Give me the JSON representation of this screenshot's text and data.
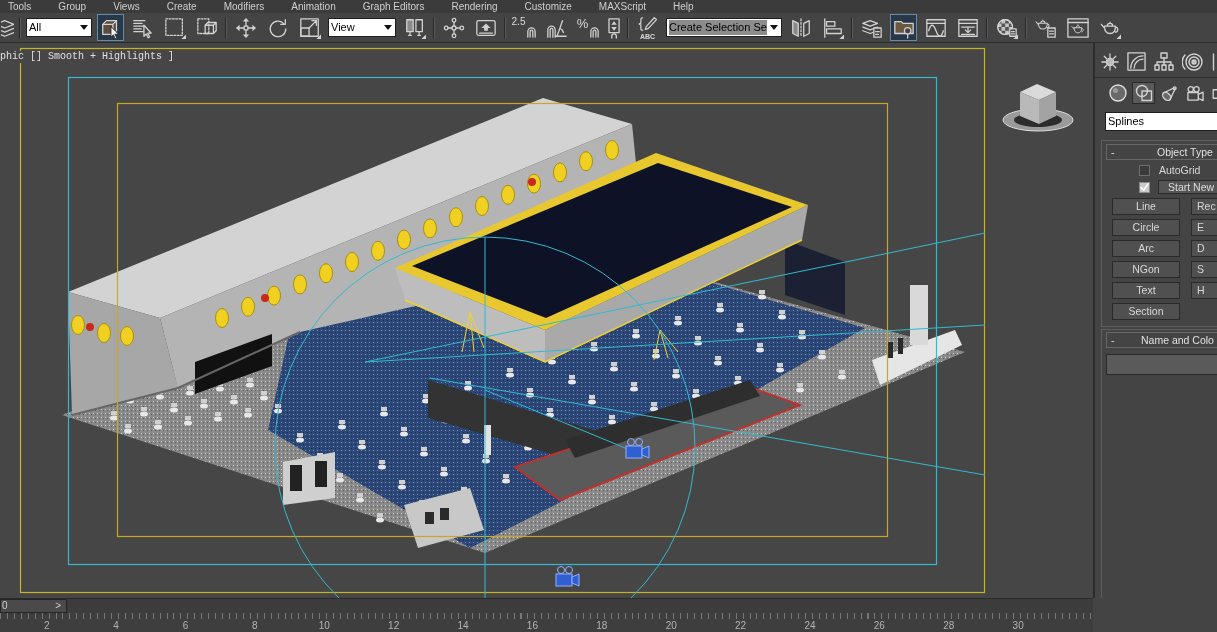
{
  "menu_bar": {
    "items": [
      "Tools",
      "Group",
      "Views",
      "Create",
      "Modifiers",
      "Animation",
      "Graph Editors",
      "Rendering",
      "Customize",
      "MAXScript",
      "Help"
    ]
  },
  "toolbar": {
    "items": [
      {
        "kind": "button",
        "selected": false
      },
      {
        "kind": "separator"
      },
      {
        "kind": "dropdown",
        "value": "All",
        "text_selected": false
      },
      {
        "kind": "button",
        "selected": true
      },
      {
        "kind": "button",
        "selected": false
      },
      {
        "kind": "button",
        "selected": false
      },
      {
        "kind": "button",
        "selected": false
      },
      {
        "kind": "separator"
      },
      {
        "kind": "button",
        "selected": false
      },
      {
        "kind": "button",
        "selected": false
      },
      {
        "kind": "button",
        "selected": false
      },
      {
        "kind": "dropdown",
        "value": "View",
        "text_selected": false
      },
      {
        "kind": "button",
        "selected": false
      },
      {
        "kind": "separator"
      },
      {
        "kind": "button",
        "selected": false
      },
      {
        "kind": "button",
        "selected": false
      },
      {
        "kind": "separator"
      },
      {
        "kind": "label_button",
        "label": "2.5",
        "selected": false
      },
      {
        "kind": "button",
        "selected": false
      },
      {
        "kind": "label_button",
        "label": "%",
        "selected": false
      },
      {
        "kind": "button",
        "selected": false
      },
      {
        "kind": "separator"
      },
      {
        "kind": "label_button",
        "label": "ABC",
        "selected": false
      },
      {
        "kind": "dropdown",
        "value": "Create Selection Se",
        "text_selected": true
      },
      {
        "kind": "button",
        "selected": false
      },
      {
        "kind": "button",
        "selected": false
      },
      {
        "kind": "separator"
      },
      {
        "kind": "button",
        "selected": false
      },
      {
        "kind": "button",
        "selected": true
      },
      {
        "kind": "button",
        "selected": false
      },
      {
        "kind": "button",
        "selected": false
      },
      {
        "kind": "separator"
      },
      {
        "kind": "button",
        "selected": false
      },
      {
        "kind": "separator"
      },
      {
        "kind": "button",
        "selected": false
      },
      {
        "kind": "button",
        "selected": false
      },
      {
        "kind": "button",
        "selected": false
      }
    ]
  },
  "viewport": {
    "label": "phic [] Smooth + Highlights ]"
  },
  "command_panel": {
    "category_icons": [
      {
        "selected": false
      },
      {
        "selected": true
      },
      {
        "selected": false
      },
      {
        "selected": false
      },
      {
        "selected": false
      }
    ],
    "category_dropdown": {
      "value": "Splines"
    },
    "object_type": {
      "toggle": "-",
      "title": "Object Type",
      "options": [
        {
          "kind": "checkbox",
          "label": "AutoGrid",
          "checked": false
        },
        {
          "kind": "checkbox_button",
          "label": "Start New",
          "checked": true
        }
      ],
      "buttons": [
        "Line",
        "Rec",
        "Circle",
        "E",
        "Arc",
        "D",
        "NGon",
        "S",
        "Text",
        "H",
        "Section"
      ]
    },
    "name_and_color": {
      "toggle": "-",
      "title": "Name and Colo"
    }
  },
  "time_slider": {
    "level": 0,
    "frame": "0",
    "next": ">"
  },
  "track_bar": {
    "ticks": [
      "2",
      "4",
      "6",
      "8",
      "10",
      "12",
      "14",
      "16",
      "18",
      "20",
      "22",
      "24",
      "26",
      "28",
      "30"
    ]
  }
}
